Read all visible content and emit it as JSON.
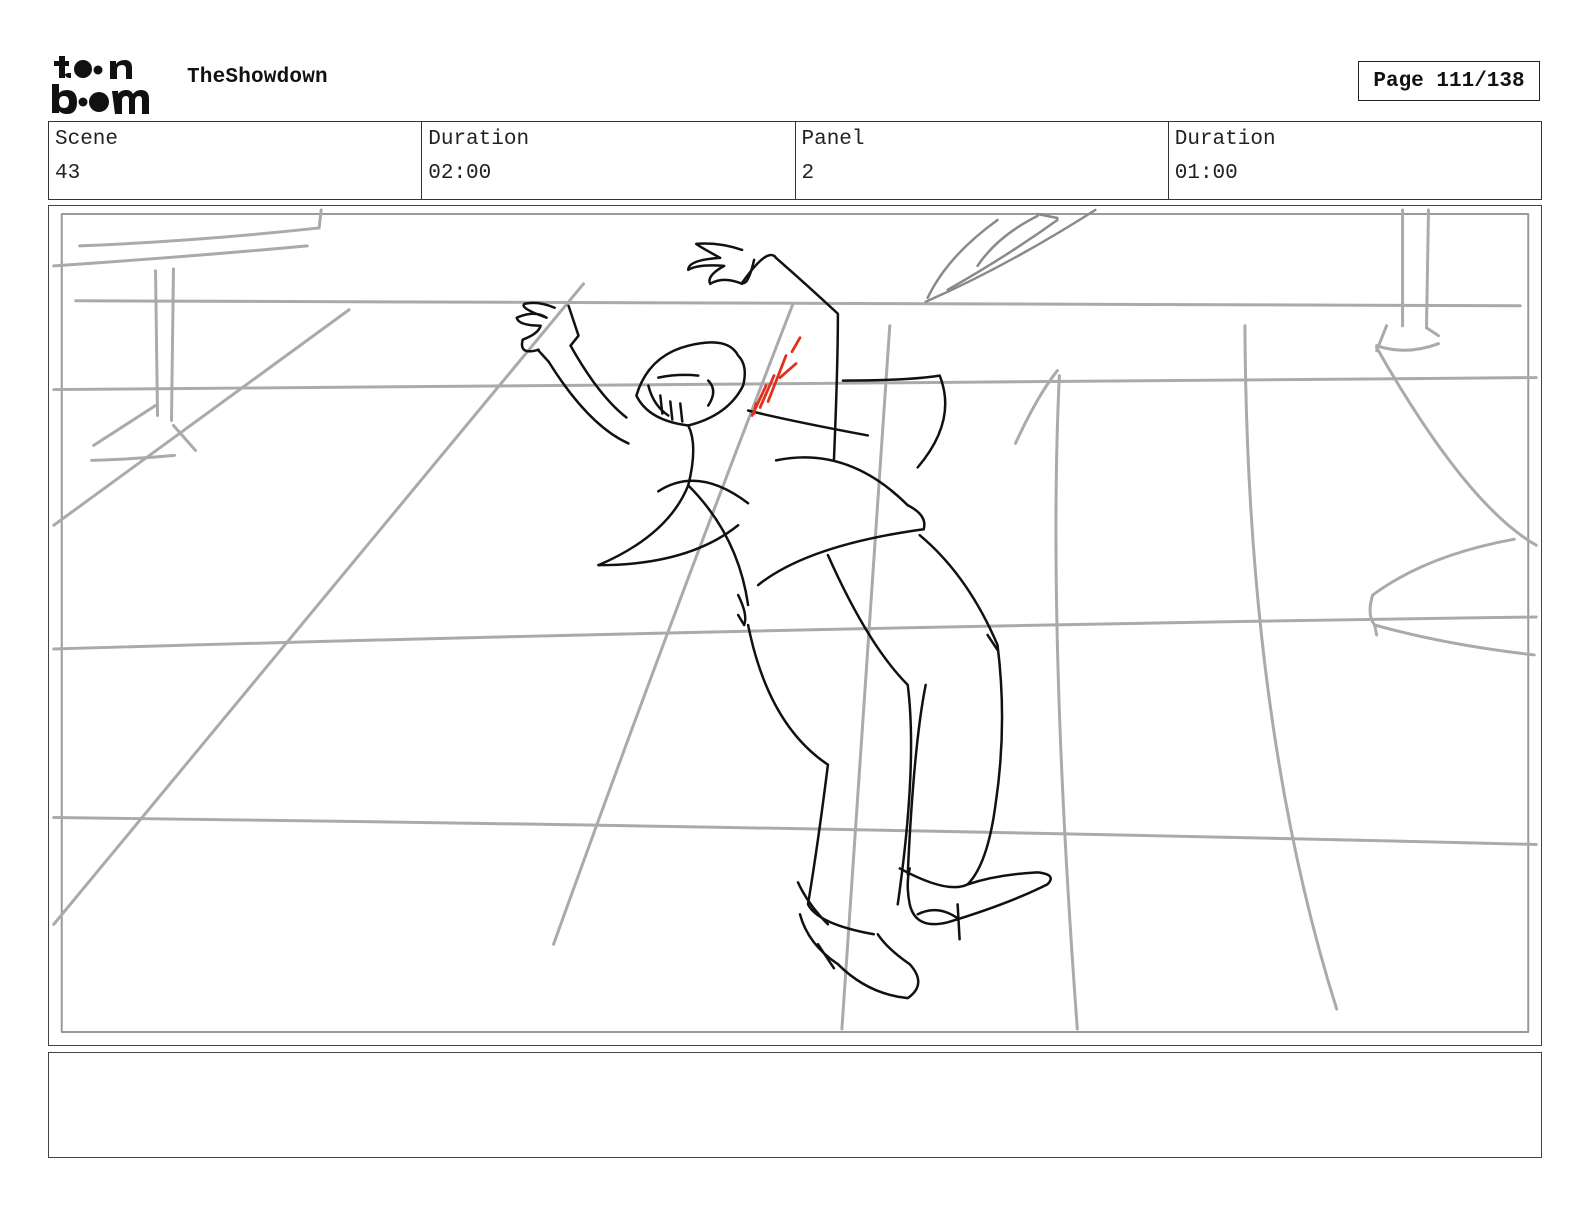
{
  "header": {
    "logo_text": "toonboom",
    "project_title": "TheShowdown",
    "page_label": "Page 111/138"
  },
  "info": {
    "scene_label": "Scene",
    "scene_value": "43",
    "scene_duration_label": "Duration",
    "scene_duration_value": "02:00",
    "panel_label": "Panel",
    "panel_value": "2",
    "panel_duration_label": "Duration",
    "panel_duration_value": "01:00"
  },
  "colors": {
    "sketch_line": "#111111",
    "guide_line": "#a8a8a8",
    "blood_accent": "#e0301e"
  },
  "notes": {
    "text": ""
  }
}
